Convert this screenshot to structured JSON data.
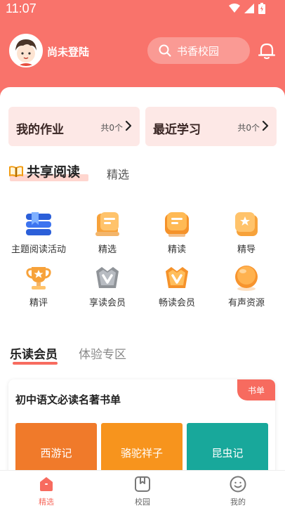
{
  "status_bar": {
    "time": "11:07"
  },
  "header": {
    "login_label": "尚未登陆",
    "search_placeholder": "书香校园"
  },
  "cards": [
    {
      "title": "我的作业",
      "count": "共0个"
    },
    {
      "title": "最近学习",
      "count": "共0个"
    }
  ],
  "shared_reading": {
    "title": "共享阅读",
    "tab": "精选",
    "items": [
      {
        "label": "主题阅读活动",
        "icon": "bookmark-stack-icon"
      },
      {
        "label": "精选",
        "icon": "scroll-icon"
      },
      {
        "label": "精读",
        "icon": "open-book-icon"
      },
      {
        "label": "精导",
        "icon": "guide-star-icon"
      },
      {
        "label": "精评",
        "icon": "trophy-icon"
      },
      {
        "label": "享读会员",
        "icon": "silver-v-icon"
      },
      {
        "label": "畅读会员",
        "icon": "gold-v-icon"
      },
      {
        "label": "有声资源",
        "icon": "audio-orb-icon"
      }
    ]
  },
  "member_section": {
    "tab_active": "乐读会员",
    "tab_inactive": "体验专区"
  },
  "book_list": {
    "title": "初中语文必读名著书单",
    "badge": "书单",
    "books": [
      "西游记",
      "骆驼祥子",
      "昆虫记"
    ]
  },
  "bottom_nav": [
    {
      "label": "精选",
      "icon": "home-icon",
      "active": true
    },
    {
      "label": "校园",
      "icon": "campus-icon",
      "active": false
    },
    {
      "label": "我的",
      "icon": "profile-icon",
      "active": false
    }
  ],
  "colors": {
    "header": "#f9736b",
    "accent": "#f76b5f",
    "card_bg": "#fde8e6"
  }
}
